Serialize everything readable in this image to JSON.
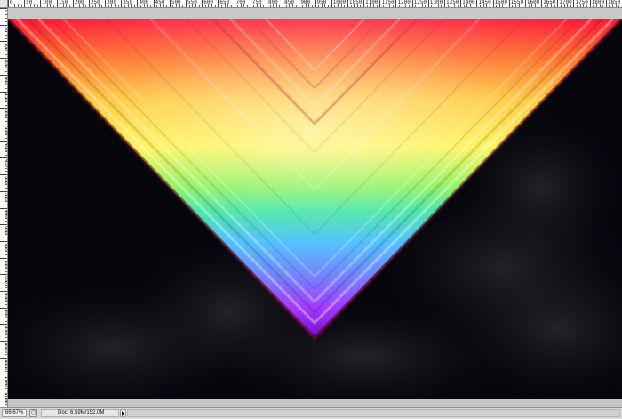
{
  "ruler": {
    "top_ticks": [
      "0",
      "50",
      "100",
      "150",
      "200",
      "250",
      "300",
      "350",
      "400",
      "450",
      "500",
      "550",
      "600",
      "650",
      "700",
      "750",
      "800",
      "850",
      "900",
      "950",
      "1000",
      "1050",
      "1100",
      "1150",
      "1200",
      "1250",
      "1300",
      "1350",
      "1400",
      "1450",
      "1500",
      "1550",
      "1600",
      "1650",
      "1700",
      "1750",
      "1800",
      "1850"
    ],
    "left_ticks": [
      "0",
      "50",
      "100",
      "150",
      "200",
      "250",
      "300",
      "350",
      "400",
      "450",
      "500",
      "550",
      "600",
      "650",
      "700",
      "750",
      "800",
      "850",
      "900",
      "950",
      "1000",
      "1050",
      "1100",
      "1150"
    ]
  },
  "status_bar": {
    "zoom": "66.67%",
    "doc_info": "Doc: 6.59M/152.0M"
  },
  "colors": {
    "canvas_background": "#05050c",
    "rainbow": [
      "#ff1a2e",
      "#ff7a1e",
      "#ffe82a",
      "#2ee84a",
      "#3aa8ff",
      "#9a2cff"
    ]
  },
  "icons": {
    "status_icon": "status-preview-icon",
    "status_arrow": "status-menu-arrow-icon"
  }
}
